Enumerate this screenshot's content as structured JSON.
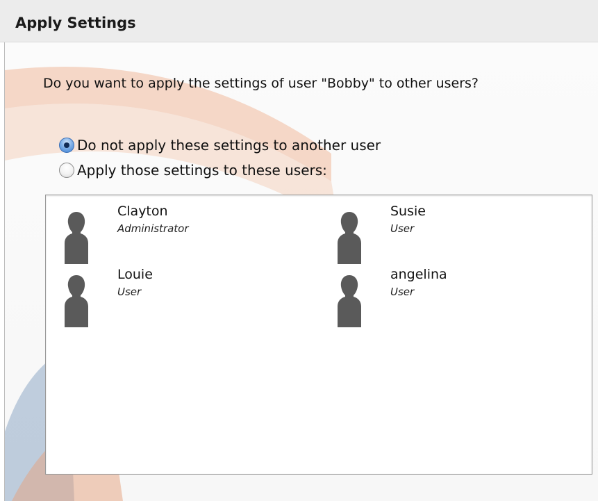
{
  "window": {
    "title": "Apply Settings"
  },
  "dialog": {
    "question": "Do you want to apply the settings of user \"Bobby\" to other users?",
    "options": [
      {
        "label": "Do not apply these settings to another user",
        "selected": true
      },
      {
        "label": "Apply those settings to these users:",
        "selected": false
      }
    ],
    "users": [
      {
        "name": "Clayton",
        "role": "Administrator",
        "icon": "user-silhouette-icon"
      },
      {
        "name": "Susie",
        "role": "User",
        "icon": "user-silhouette-icon"
      },
      {
        "name": "Louie",
        "role": "User",
        "icon": "user-silhouette-icon"
      },
      {
        "name": "angelina",
        "role": "User",
        "icon": "user-silhouette-icon"
      }
    ]
  },
  "colors": {
    "accent_radio": "#3d7fd2",
    "avatar": "#5a5a5a",
    "background_swoosh": "#e8875a"
  }
}
